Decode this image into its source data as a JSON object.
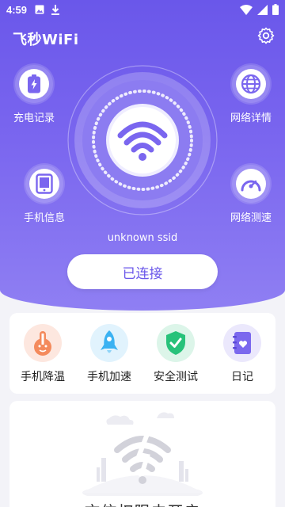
{
  "status_bar": {
    "time": "4:59",
    "icons_left": [
      "image-icon",
      "download-icon"
    ],
    "icons_right": [
      "wifi-icon",
      "signal-icon",
      "battery-icon"
    ]
  },
  "header": {
    "title": "飞秒WiFi",
    "settings_icon": "gear-icon"
  },
  "side_actions": {
    "charge_record": "充电记录",
    "network_details": "网络详情",
    "phone_info": "手机信息",
    "network_speed": "网络测速"
  },
  "wifi": {
    "ssid": "unknown ssid",
    "connect_status": "已连接"
  },
  "tools": [
    {
      "label": "手机降温",
      "icon": "thermometer-icon",
      "color": "#f48a5c"
    },
    {
      "label": "手机加速",
      "icon": "rocket-icon",
      "color": "#3bb2f2"
    },
    {
      "label": "安全测试",
      "icon": "shield-icon",
      "color": "#27c27a"
    },
    {
      "label": "日记",
      "icon": "diary-icon",
      "color": "#7b68ee"
    }
  ],
  "bottom": {
    "text": "充信权限未开启"
  },
  "colors": {
    "accent": "#6a57ea",
    "hero_light": "#8f7ff3"
  }
}
